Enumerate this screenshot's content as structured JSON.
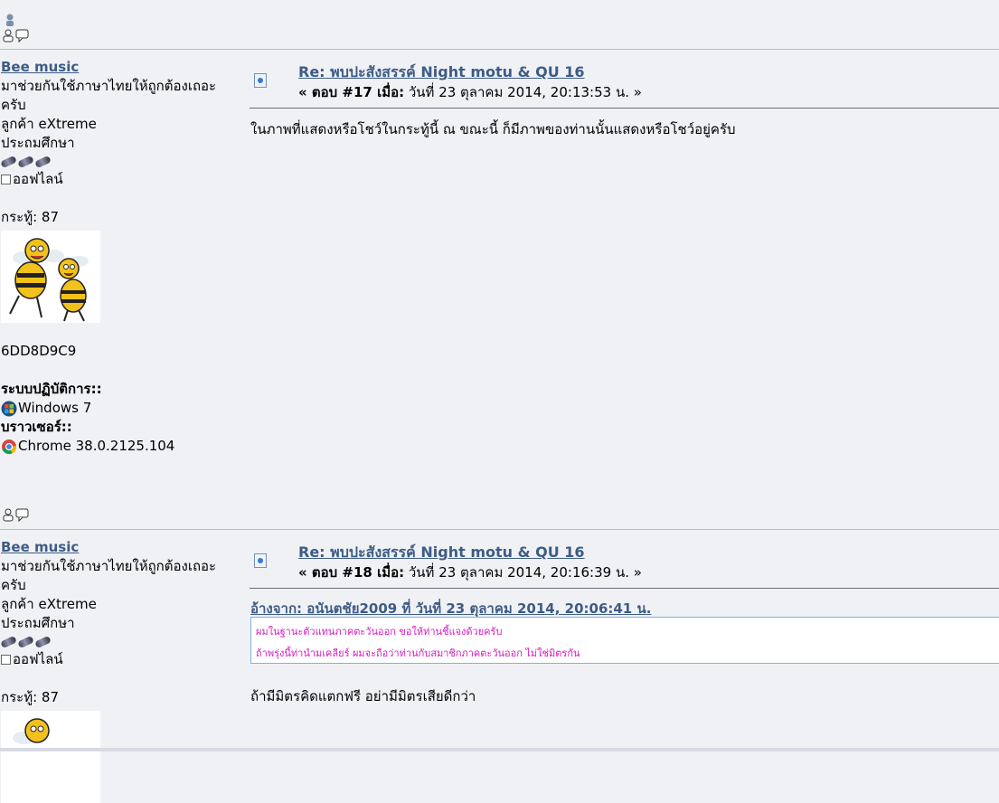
{
  "posts": [
    {
      "poster": {
        "name": "Bee music",
        "tagline_1": "มาช่วยกันใช้ภาษาไทยให้ถูกต้องเถอะ",
        "tagline_2": "ครับ",
        "group": "ลูกค้า eXtreme",
        "rank": "ประถมศึกษา",
        "status": "ออฟไลน์",
        "posts_label": "กระทู้: 87",
        "signature": "6DD8D9C9",
        "os_label": "ระบบปฏิบัติการ::",
        "os_value": "Windows 7",
        "browser_label": "บราวเซอร์::",
        "browser_value": "Chrome 38.0.2125.104"
      },
      "subject": "Re: พบปะสังสรรค์ Night motu & QU 16",
      "meta_prefix": "« ตอบ #17 เมื่อ:",
      "meta_date": " วันที่ 23 ตุลาคม 2014, 20:13:53 น. »",
      "body": "ในภาพที่แสดงหรือโชว์ในกระทู้นี้ ณ ขณะนี้ ก็มีภาพของท่านนั้นแสดงหรือโชว์อยู่ครับ"
    },
    {
      "poster": {
        "name": "Bee music",
        "tagline_1": "มาช่วยกันใช้ภาษาไทยให้ถูกต้องเถอะ",
        "tagline_2": "ครับ",
        "group": "ลูกค้า eXtreme",
        "rank": "ประถมศึกษา",
        "status": "ออฟไลน์",
        "posts_label": "กระทู้: 87"
      },
      "subject": "Re: พบปะสังสรรค์ Night motu & QU 16",
      "meta_prefix": "« ตอบ #18 เมื่อ:",
      "meta_date": " วันที่ 23 ตุลาคม 2014, 20:16:39 น. »",
      "quote_header": "อ้างจาก: อนันตชัย2009 ที่ วันที่ 23 ตุลาคม  2014, 20:06:41 น.",
      "quote_line_1": "ผมในฐานะตัวแทนภาคตะวันออก ขอให้ท่านชี้แจงด้วยครับ",
      "quote_line_2": "ถ้าพรุ่งนี้ท่านำมเคลียร์ ผมจะถือว่าท่านกับสมาชิกภาคตะวันออก ไม่ใช่มิตรกัน",
      "body": "ถ้ามีมิตรคิดแตกฟรี อย่ามีมิตรเสียดีกว่า"
    }
  ],
  "colors": {
    "link": "#3d5c86",
    "quote_text": "#d21cc1",
    "quote_border": "#7ab4d8",
    "background": "#f0f1f5"
  }
}
